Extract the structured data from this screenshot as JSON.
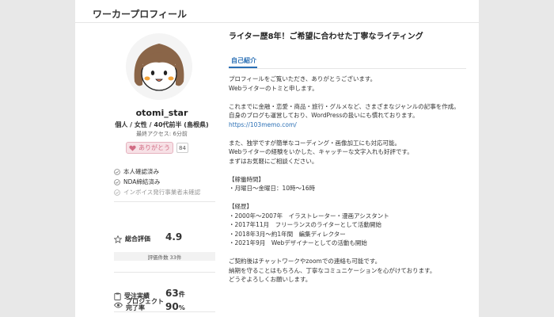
{
  "header": {
    "title": "ワーカープロフィール"
  },
  "profile": {
    "username": "otomi_star",
    "demographics": "個人 / 女性 / 40代前半 (島根県)",
    "last_access": "最終アクセス: 6分前",
    "thanks_label": "ありがとう",
    "thanks_count": "84",
    "verifications": [
      {
        "label": "本人確認済み",
        "verified": true
      },
      {
        "label": "NDA締結済み",
        "verified": true
      },
      {
        "label": "インボイス発行事業者未確認",
        "verified": false
      }
    ]
  },
  "stats": {
    "rating_label": "総合評価",
    "rating_value": "4.9",
    "review_count": "評価件数 33件",
    "orders_label": "受注実績",
    "orders_value": "63",
    "orders_unit": "件",
    "completion_label_1": "プロジェクト",
    "completion_label_2": "完了率",
    "completion_value": "90",
    "completion_unit": "%"
  },
  "intro": {
    "headline": "ライター歴8年！ご希望に合わせた丁寧なライティング",
    "tab_label": "自己紹介",
    "lines": [
      {
        "text": "プロフィールをご覧いただき、ありがとうございます。",
        "link": false
      },
      {
        "text": "Webライターのトミと申します。",
        "link": false
      },
      {
        "text": "",
        "link": false
      },
      {
        "text": "これまでに金融・恋愛・商品・旅行・グルメなど、さまざまなジャンルの記事を作成。",
        "link": false
      },
      {
        "text": "自身のブログも運営しており、WordPressの扱いにも慣れております。",
        "link": false
      },
      {
        "text": "https://103memo.com/",
        "link": true
      },
      {
        "text": "",
        "link": false
      },
      {
        "text": "また、独学ですが簡単なコーディング・画像加工にも対応可能。",
        "link": false
      },
      {
        "text": "Webライターの経験をいかした、キャッチーな文字入れも好評です。",
        "link": false
      },
      {
        "text": "まずはお気軽にご相談ください。",
        "link": false
      },
      {
        "text": "",
        "link": false
      },
      {
        "text": "【稼働時間】",
        "link": false
      },
      {
        "text": "・月曜日～金曜日：10時～16時",
        "link": false
      },
      {
        "text": "",
        "link": false
      },
      {
        "text": "【経歴】",
        "link": false
      },
      {
        "text": "・2000年～2007年　イラストレーター・漫画アシスタント",
        "link": false
      },
      {
        "text": "・2017年11月　フリーランスのライターとして活動開始",
        "link": false
      },
      {
        "text": "・2018年3月～約1年間　編集ディレクター",
        "link": false
      },
      {
        "text": "・2021年9月　Webデザイナーとしての活動も開始",
        "link": false
      },
      {
        "text": "",
        "link": false
      },
      {
        "text": "ご契約後はチャットワークやzoomでの連絡も可能です。",
        "link": false
      },
      {
        "text": "納期を守ることはもちろん、丁寧なコミュニケーションを心がけております。",
        "link": false
      },
      {
        "text": "どうぞよろしくお願いします。",
        "link": false
      }
    ]
  },
  "colors": {
    "accent": "#2a6fb5",
    "thanks": "#d16b83"
  }
}
